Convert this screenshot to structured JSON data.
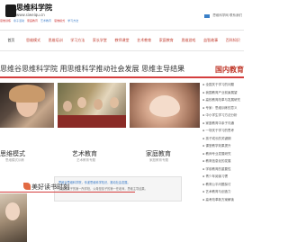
{
  "header": {
    "logo_text": "思维科学院",
    "logo_url": "www.siweiqu.cn",
    "top_right": "思维科学网 联系我们",
    "sublinks": [
      "思维训练",
      "亲子活动",
      "家庭教育",
      "艺术教育",
      "思维模式",
      "学习方法"
    ]
  },
  "nav": {
    "items": [
      "首页",
      "思维模式",
      "思维培训",
      "学习方法",
      "家长学堂",
      "教师课堂",
      "艺术教育",
      "家庭教育",
      "思维游戏",
      "益智故事",
      "百科知识"
    ]
  },
  "banner": {
    "slogan": "思维谷思维科学院   用思维科学推动社会发展   思维主导结果",
    "section_title": "国内教育"
  },
  "features": [
    {
      "title": "思维模式",
      "subtitle": "思维模式训练"
    },
    {
      "title": "艺术教育",
      "subtitle": "艺术教育专题"
    },
    {
      "title": "家庭教育",
      "subtitle": "家庭教育专题"
    }
  ],
  "news": [
    "全国关于学习的问题",
    "我国教育产业前景展望",
    "高校教育改革与发展研究",
    "专家：思维训练的意义",
    "中小学生学习方法分析",
    "家庭教育中亲子沟通",
    "一场关于学习的思考",
    "孩子成长的关键期",
    "课堂教学效果提升",
    "教师专业发展研究",
    "教育信息化的发展",
    "学前教育的重要性",
    "青少年阅读习惯",
    "教育公平问题探讨",
    "艺术教育与创造力",
    "高考改革新方案解读"
  ],
  "notice": {
    "line1": "思维谷思维科学院，传递思维科学知识，推动社会发展。",
    "line2": "家庭是孩子的第一所学校，父母是孩子的第一任老师，思维主导结果。"
  },
  "reading": {
    "title": "美好读书时刻"
  },
  "colors": {
    "accent": "#d43d3d",
    "link": "#3a7bc8"
  }
}
